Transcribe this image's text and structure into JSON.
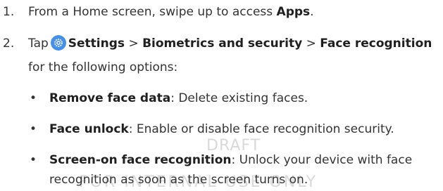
{
  "watermark": {
    "line1": "DRAFT",
    "line2": "FOR INTERNAL USE ONLY"
  },
  "steps": [
    {
      "number": "1.",
      "text_before": "From a Home screen, swipe up to access ",
      "bold": "Apps",
      "text_after": "."
    },
    {
      "number": "2.",
      "tap": "Tap",
      "settings_icon": "settings-gear-icon",
      "path1": "Settings",
      "sep1": ">",
      "path2": "Biometrics and security",
      "sep2": ">",
      "path3": "Face recognition",
      "continuation": "for the following options:"
    }
  ],
  "options": [
    {
      "term": "Remove face data",
      "desc": ": Delete existing faces."
    },
    {
      "term": "Face unlock",
      "desc": ": Enable or disable face recognition security."
    },
    {
      "term": "Screen-on face recognition",
      "desc": ": Unlock your device with face",
      "desc2": "recognition as soon as the screen turns on."
    }
  ],
  "colors": {
    "settings_icon_bg": "#4a90e2",
    "watermark": "#d9d9d9"
  }
}
